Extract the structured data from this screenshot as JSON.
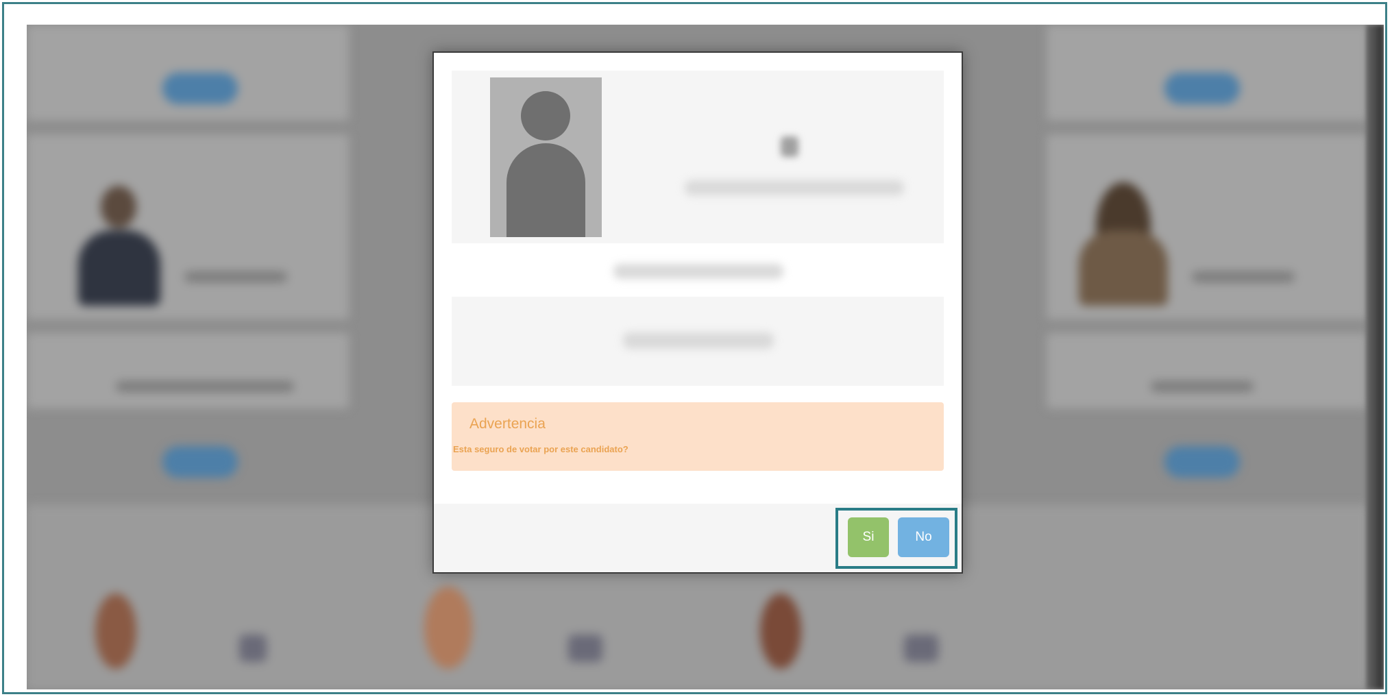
{
  "colors": {
    "frame_border": "#3c8088",
    "highlight_border": "#297c86",
    "alert_background": "#fde0c9",
    "alert_text": "#eaa352",
    "confirm_button": "#93c26a",
    "cancel_button": "#72b2e1"
  },
  "background": {
    "state": "blurred candidate grid behind modal"
  },
  "modal": {
    "avatar_icon": "user-silhouette-icon",
    "alert": {
      "title": "Advertencia",
      "message": "Esta seguro de votar por este candidato?"
    },
    "footer": {
      "confirm_label": "Si",
      "cancel_label": "No"
    }
  }
}
